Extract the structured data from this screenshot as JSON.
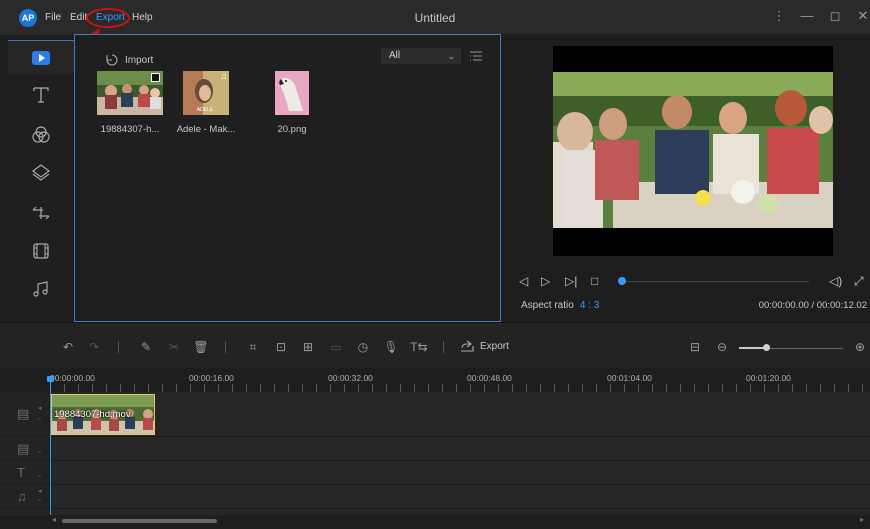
{
  "app": {
    "logo_text": "AP",
    "title": "Untitled"
  },
  "menu": {
    "file": "File",
    "edit": "Edit",
    "export": "Export",
    "help": "Help"
  },
  "window_controls": [
    "⋮",
    "—",
    "◻",
    "✕"
  ],
  "library": {
    "import_label": "Import",
    "filter_value": "All",
    "items": [
      {
        "name": "19884307-h...",
        "type": "video"
      },
      {
        "name": "Adele - Mak...",
        "type": "audio",
        "thumb_text": "ADELE"
      },
      {
        "name": "20.png",
        "type": "image"
      }
    ]
  },
  "preview": {
    "aspect_label": "Aspect ratio",
    "aspect_value": "4 : 3",
    "timecode": "00:00:00.00 / 00:00:12.02"
  },
  "timeline_toolbar": {
    "export_label": "Export"
  },
  "ruler": {
    "labels": [
      "00:00:00.00",
      "00:00:16.00",
      "00:00:32.00",
      "00:00:48.00",
      "00:01:04.00",
      "00:01:20.00"
    ]
  },
  "tracks": {
    "video_clip_label": "19884307-hd.mov"
  },
  "colors": {
    "accent": "#3a9bff",
    "highlight": "#d01010",
    "clip_border": "#e9c36a"
  }
}
